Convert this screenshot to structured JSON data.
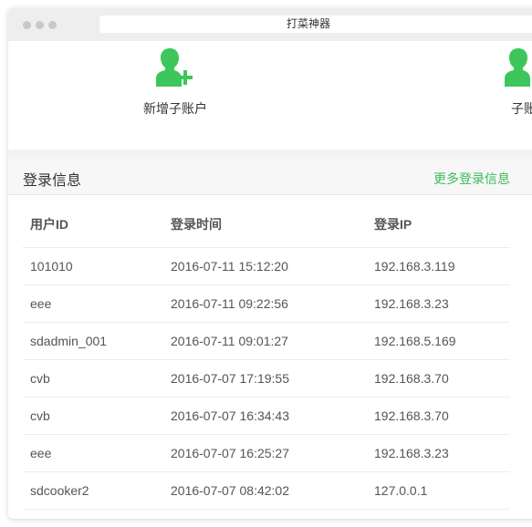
{
  "window": {
    "title": "打菜神器"
  },
  "quick_actions": [
    {
      "label": "新增子账户",
      "icon": "add-user-icon"
    },
    {
      "label": "子账",
      "icon": "user-icon"
    }
  ],
  "login_info": {
    "title": "登录信息",
    "more_link": "更多登录信息",
    "columns": [
      "用户ID",
      "登录时间",
      "登录IP"
    ],
    "rows": [
      [
        "101010",
        "2016-07-11 15:12:20",
        "192.168.3.119"
      ],
      [
        "eee",
        "2016-07-11 09:22:56",
        "192.168.3.23"
      ],
      [
        "sdadmin_001",
        "2016-07-11 09:01:27",
        "192.168.5.169"
      ],
      [
        "cvb",
        "2016-07-07 17:19:55",
        "192.168.3.70"
      ],
      [
        "cvb",
        "2016-07-07 16:34:43",
        "192.168.3.70"
      ],
      [
        "eee",
        "2016-07-07 16:25:27",
        "192.168.3.23"
      ],
      [
        "sdcooker2",
        "2016-07-07 08:42:02",
        "127.0.0.1"
      ]
    ]
  },
  "colors": {
    "accent": "#3dbb5b",
    "icon_green": "#3cc65c"
  }
}
